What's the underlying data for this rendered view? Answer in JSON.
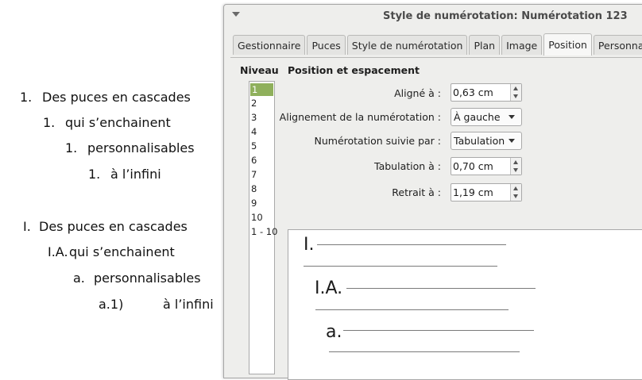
{
  "document": {
    "arabic_list": [
      {
        "num": "1.",
        "text": "Des puces en cascades"
      },
      {
        "num": "1.",
        "text": "qui s’enchainent"
      },
      {
        "num": "1.",
        "text": "personnalisables"
      },
      {
        "num": "1.",
        "text": "à l’infini"
      }
    ],
    "roman_list": [
      {
        "num": "I.",
        "text": "Des puces en cascades"
      },
      {
        "num": "I.A.",
        "text": "qui s’enchainent"
      },
      {
        "num": "a.",
        "text": "personnalisables"
      },
      {
        "num": "a.1)",
        "text": "à l’infini"
      }
    ]
  },
  "dialog": {
    "title": "Style de numérotation: Numérotation 123",
    "tabs": [
      "Gestionnaire",
      "Puces",
      "Style de numérotation",
      "Plan",
      "Image",
      "Position",
      "Personnaliser"
    ],
    "active_tab": "Position",
    "level": {
      "label": "Niveau",
      "items": [
        "1",
        "2",
        "3",
        "4",
        "5",
        "6",
        "7",
        "8",
        "9",
        "10",
        "1 - 10"
      ],
      "selected": "1"
    },
    "section_title": "Position et espacement",
    "fields": {
      "aligned_at": {
        "label": "Aligné à :",
        "value": "0,63 cm"
      },
      "numbering_alignment": {
        "label": "Alignement de la numérotation :",
        "value": "À gauche"
      },
      "numbering_followed_by": {
        "label": "Numérotation suivie par :",
        "value": "Tabulation"
      },
      "tab_stop_at": {
        "label": "Tabulation à :",
        "value": "0,70 cm"
      },
      "indent_at": {
        "label": "Retrait à :",
        "value": "1,19 cm"
      }
    },
    "preview": {
      "labels": [
        "I.",
        "I.A.",
        "a."
      ]
    }
  },
  "colors": {
    "selection": "#8fb05c",
    "dialog_bg": "#eeeeec"
  }
}
